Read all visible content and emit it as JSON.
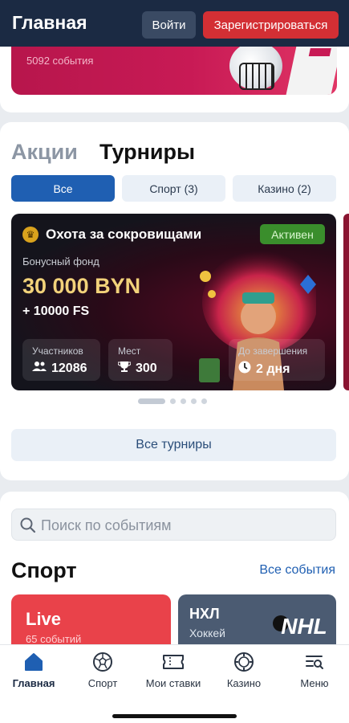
{
  "header": {
    "title": "Главная",
    "login_label": "Войти",
    "register_label": "Зарегистрироваться"
  },
  "top_banner": {
    "events_text": "5092 события"
  },
  "promotions": {
    "tabs": [
      {
        "label": "Акции",
        "active": false
      },
      {
        "label": "Турниры",
        "active": true
      }
    ],
    "filters": [
      {
        "label": "Все",
        "active": true
      },
      {
        "label": "Спорт (3)",
        "active": false
      },
      {
        "label": "Казино (2)",
        "active": false
      }
    ],
    "tournament": {
      "title": "Охота за сокровищами",
      "status": "Активен",
      "fund_label": "Бонусный фонд",
      "fund_value": "30 000 BYN",
      "fund_extra": "+ 10000 FS",
      "stats": [
        {
          "label": "Участников",
          "value": "12086",
          "icon": "users-icon"
        },
        {
          "label": "Мест",
          "value": "300",
          "icon": "trophy-icon"
        },
        {
          "label": "До завершения",
          "value": "2 дня",
          "icon": "clock-icon"
        }
      ]
    },
    "carousel": {
      "pages": 5,
      "active_index": 0
    },
    "all_tournaments_label": "Все турниры"
  },
  "sport": {
    "search_placeholder": "Поиск по событиям",
    "title": "Спорт",
    "all_events_label": "Все события",
    "cards": [
      {
        "title": "Live",
        "subtitle": "65 событий",
        "color": "#e9424a"
      },
      {
        "title": "НХЛ",
        "subtitle": "Хоккей",
        "logo_text": "NHL",
        "color": "#4b5b72"
      }
    ]
  },
  "bottom_nav": [
    {
      "label": "Главная",
      "icon": "home-icon",
      "active": true
    },
    {
      "label": "Спорт",
      "icon": "soccer-ball-icon",
      "active": false
    },
    {
      "label": "Мои ставки",
      "icon": "ticket-icon",
      "active": false
    },
    {
      "label": "Казино",
      "icon": "casino-chip-icon",
      "active": false
    },
    {
      "label": "Меню",
      "icon": "menu-search-icon",
      "active": false
    }
  ],
  "colors": {
    "header_bg": "#1b2a43",
    "register": "#d32f34",
    "primary": "#1f5fb2",
    "active_badge": "#3a8e2c",
    "fund_gold": "#f2d27a"
  }
}
